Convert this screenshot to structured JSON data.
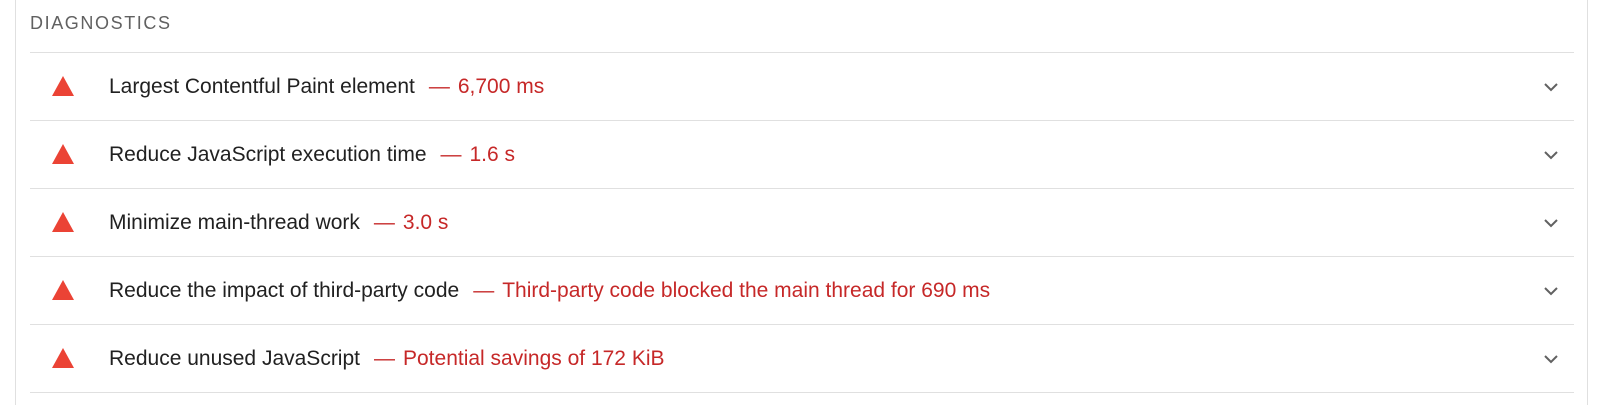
{
  "section": {
    "title": "DIAGNOSTICS"
  },
  "colors": {
    "fail": "#eb4335",
    "fail_text": "#c62828",
    "text": "#212121",
    "muted": "#616161",
    "divider": "#e0e0e0"
  },
  "audits": [
    {
      "title": "Largest Contentful Paint element",
      "separator": "—",
      "display_value": "6,700 ms",
      "icon": "warning-triangle-icon",
      "expand_icon": "chevron-down-icon"
    },
    {
      "title": "Reduce JavaScript execution time",
      "separator": "—",
      "display_value": "1.6 s",
      "icon": "warning-triangle-icon",
      "expand_icon": "chevron-down-icon"
    },
    {
      "title": "Minimize main-thread work",
      "separator": "—",
      "display_value": "3.0 s",
      "icon": "warning-triangle-icon",
      "expand_icon": "chevron-down-icon"
    },
    {
      "title": "Reduce the impact of third-party code",
      "separator": "—",
      "display_value": "Third-party code blocked the main thread for 690 ms",
      "icon": "warning-triangle-icon",
      "expand_icon": "chevron-down-icon"
    },
    {
      "title": "Reduce unused JavaScript",
      "separator": "—",
      "display_value": "Potential savings of 172 KiB",
      "icon": "warning-triangle-icon",
      "expand_icon": "chevron-down-icon"
    }
  ]
}
